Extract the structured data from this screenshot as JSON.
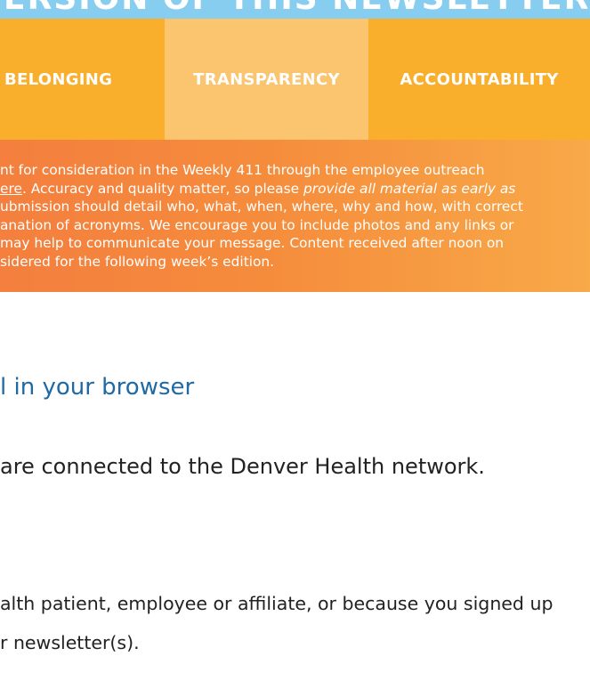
{
  "banner": {
    "heading": "ERSION OF THIS NEWSLETTER:"
  },
  "values": {
    "items": [
      "BELONGING",
      "TRANSPARENCY",
      "ACCOUNTABILITY"
    ]
  },
  "submission_info": {
    "line1": "nt for consideration in the Weekly 411 through the employee outreach",
    "line2_link": "ere",
    "line2_text": ". Accuracy and quality matter, so please ",
    "line2_italic": "provide all material as early as",
    "line3": "ubmission should detail who, what, when, where, why and how, with correct",
    "line4": "anation of acronyms. We encourage you to include photos and any links or",
    "line5": "may help to communicate your message. Content received after noon on",
    "line6": "sidered for the following week’s edition."
  },
  "browser_link": {
    "label": "l in your browser"
  },
  "network_note": {
    "text": "are connected to the Denver Health network."
  },
  "footer": {
    "line1": "alth patient, employee or affiliate, or because you signed up",
    "line2": "r newsletter(s)."
  },
  "colors": {
    "banner": "#87cdf0",
    "values_row": "#f9ae2c",
    "values_highlight": "#fbc46e",
    "info_gradient_start": "#f47f3e",
    "info_gradient_end": "#f8a948",
    "link": "#1f6aa5"
  }
}
